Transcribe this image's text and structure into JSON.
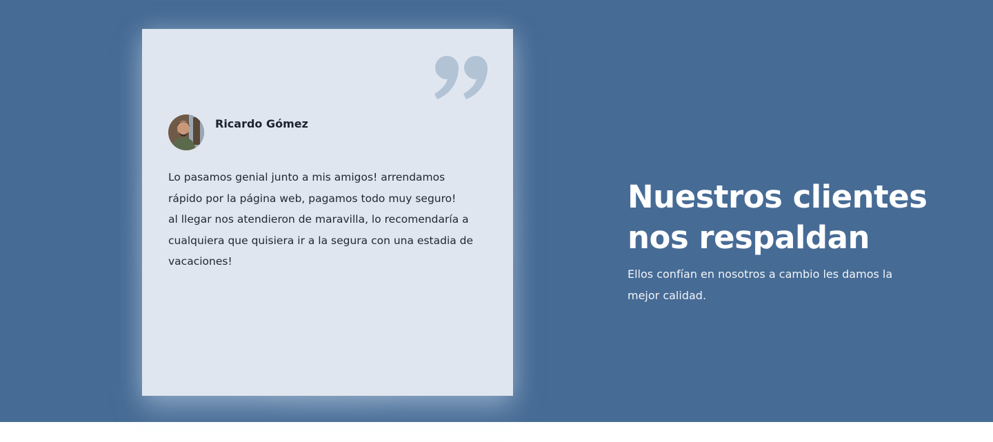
{
  "testimonial": {
    "author_name": "Ricardo Gómez",
    "review_text": "Lo pasamos genial junto a mis amigos! arrendamos\nrápido por la página web, pagamos todo muy seguro!\nal llegar nos atendieron de maravilla, lo recomendaría a\ncualquiera que quisiera ir a la segura con una estadia de\nvacaciones!",
    "quote_icon": "quote-icon",
    "avatar_icon": "avatar"
  },
  "section": {
    "title": "Nuestros clientes\nnos respaldan",
    "subtitle": "Ellos confían en nosotros a cambio les damos la\nmejor calidad."
  },
  "colors": {
    "section_background": "#466b95",
    "card_background": "#e0e6ef",
    "quote_mark": "#b2c3d5",
    "heading_text": "#ffffff",
    "body_text": "#1e2632"
  }
}
